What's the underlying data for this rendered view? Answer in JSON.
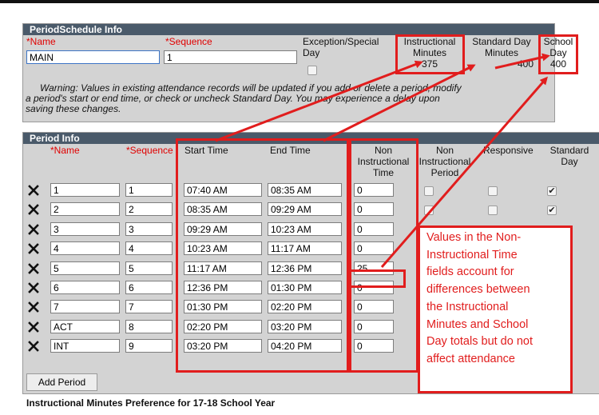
{
  "schedule_info": {
    "title": "PeriodSchedule Info",
    "name_label": "*Name",
    "sequence_label": "*Sequence",
    "exception_label_1": "Exception/Special",
    "exception_label_2": "Day",
    "instr_label_1": "Instructional",
    "instr_label_2": "Minutes",
    "instr_value": "375",
    "std_label_1": "Standard Day",
    "std_label_2": "Minutes",
    "std_value": "400",
    "school_label_1": "School",
    "school_label_2": "Day",
    "school_value": "400",
    "name_value": "MAIN",
    "sequence_value": "1",
    "warning_1": "Warning: Values in existing attendance records will be updated if you add or delete a period, modify",
    "warning_2": "a period's start or end time, or check or uncheck Standard Day. You may experience a delay upon",
    "warning_3": "saving these changes."
  },
  "period_info": {
    "title": "Period Info",
    "headers": {
      "name": "*Name",
      "sequence": "*Sequence",
      "start": "Start Time",
      "end": "End Time",
      "nonins_time_1": "Non",
      "nonins_time_2": "Instructional",
      "nonins_time_3": "Time",
      "nonins_period_1": "Non",
      "nonins_period_2": "Instructional",
      "nonins_period_3": "Period",
      "responsive": "Responsive",
      "standard_1": "Standard",
      "standard_2": "Day"
    },
    "rows": [
      {
        "name": "1",
        "seq": "1",
        "start": "07:40 AM",
        "end": "08:35 AM",
        "nonins": "0",
        "standard": "✔"
      },
      {
        "name": "2",
        "seq": "2",
        "start": "08:35 AM",
        "end": "09:29 AM",
        "nonins": "0",
        "standard": "✔"
      },
      {
        "name": "3",
        "seq": "3",
        "start": "09:29 AM",
        "end": "10:23 AM",
        "nonins": "0",
        "standard": ""
      },
      {
        "name": "4",
        "seq": "4",
        "start": "10:23 AM",
        "end": "11:17 AM",
        "nonins": "0",
        "standard": ""
      },
      {
        "name": "5",
        "seq": "5",
        "start": "11:17 AM",
        "end": "12:36 PM",
        "nonins": "25",
        "standard": ""
      },
      {
        "name": "6",
        "seq": "6",
        "start": "12:36 PM",
        "end": "01:30 PM",
        "nonins": "0",
        "standard": ""
      },
      {
        "name": "7",
        "seq": "7",
        "start": "01:30 PM",
        "end": "02:20 PM",
        "nonins": "0",
        "standard": ""
      },
      {
        "name": "ACT",
        "seq": "8",
        "start": "02:20 PM",
        "end": "03:20 PM",
        "nonins": "0",
        "standard": ""
      },
      {
        "name": "INT",
        "seq": "9",
        "start": "03:20 PM",
        "end": "04:20 PM",
        "nonins": "0",
        "standard": ""
      }
    ],
    "add_period": "Add Period"
  },
  "callout": {
    "lines": [
      "Values in the Non-",
      "Instructional Time",
      "fields account for",
      "differences between",
      "the Instructional",
      "Minutes and School",
      "Day totals but do not",
      "affect attendance"
    ]
  },
  "footer": "Instructional Minutes Preference for 17-18 School Year",
  "colors": {
    "annotation": "#e11d1d",
    "panel": "#d3d3d3",
    "header": "#4a5a6a"
  }
}
